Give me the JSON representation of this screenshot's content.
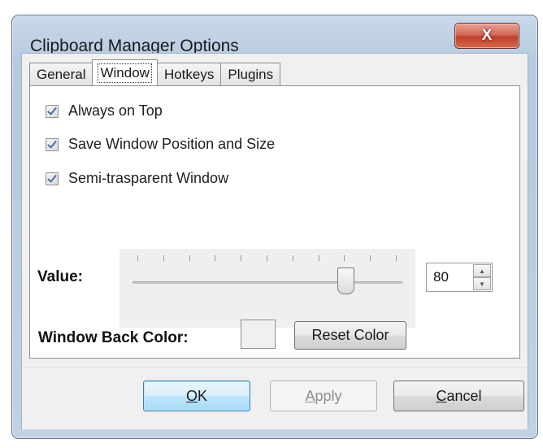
{
  "window": {
    "title": "Clipboard Manager Options",
    "close_label": "X"
  },
  "tabs": [
    {
      "label": "General"
    },
    {
      "label": "Window",
      "active": true
    },
    {
      "label": "Hotkeys"
    },
    {
      "label": "Plugins"
    }
  ],
  "options": {
    "always_on_top": {
      "label": "Always on Top",
      "checked": true
    },
    "save_position": {
      "label": "Save Window Position and Size",
      "checked": true
    },
    "semi_transparent": {
      "label": "Semi-trasparent Window",
      "checked": true
    }
  },
  "value": {
    "label": "Value:",
    "number": "80",
    "slider_fraction": 0.79
  },
  "back_color": {
    "label": "Window Back Color:",
    "reset_label": "Reset Color"
  },
  "buttons": {
    "ok": {
      "mnemonic": "O",
      "rest": "K"
    },
    "apply": {
      "mnemonic": "A",
      "rest": "pply"
    },
    "cancel": {
      "mnemonic": "C",
      "rest": "ancel"
    }
  },
  "colors": {
    "close_button": "#c0402b",
    "ok_border": "#3c7fb1",
    "checkmark": "#4a6fa8"
  }
}
